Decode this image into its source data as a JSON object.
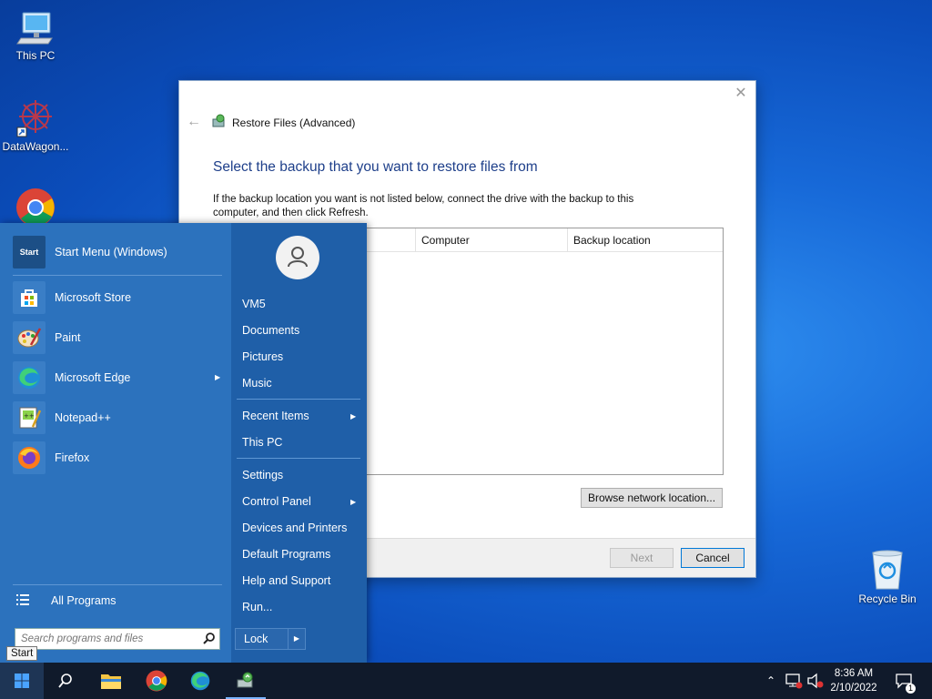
{
  "desktop": {
    "icons": [
      {
        "label": "This PC",
        "icon": "monitor-icon"
      },
      {
        "label": "DataWagon...",
        "icon": "datawagon-icon"
      },
      {
        "label": "",
        "icon": "chrome-icon"
      },
      {
        "label": "Recycle Bin",
        "icon": "recycle-bin-icon"
      }
    ]
  },
  "dialog": {
    "title": "Restore Files (Advanced)",
    "heading": "Select the backup that you want to restore files from",
    "description": "If the backup location you want is not listed below, connect the drive with the backup to this computer, and then click Refresh.",
    "columns": [
      "Computer",
      "Backup location"
    ],
    "browse_button": "Browse network location...",
    "next_button": "Next",
    "cancel_button": "Cancel"
  },
  "start_menu": {
    "pinned": [
      {
        "label": "Start Menu (Windows)",
        "icon": "start-menu-icon"
      },
      {
        "label": "Microsoft Store",
        "icon": "store-icon"
      },
      {
        "label": "Paint",
        "icon": "paint-icon"
      },
      {
        "label": "Microsoft Edge",
        "icon": "edge-icon"
      },
      {
        "label": "Notepad++",
        "icon": "notepad-icon"
      },
      {
        "label": "Firefox",
        "icon": "firefox-icon"
      }
    ],
    "start_icon_text": "Start",
    "all_programs": "All Programs",
    "search_placeholder": "Search programs and files",
    "user_name": "VM5",
    "right_items": {
      "documents": "Documents",
      "pictures": "Pictures",
      "music": "Music",
      "recent_items": "Recent Items",
      "this_pc": "This PC",
      "settings": "Settings",
      "control_panel": "Control Panel",
      "devices_printers": "Devices and Printers",
      "default_programs": "Default Programs",
      "help_support": "Help and Support",
      "run": "Run..."
    },
    "lock_button": "Lock",
    "tooltip": "Start"
  },
  "taskbar": {
    "time": "8:36 AM",
    "date": "2/10/2022",
    "notification_count": "1"
  },
  "colors": {
    "start_left": "#2c72bd",
    "start_right": "#1f5fa8",
    "taskbar": "#101a2b",
    "heading": "#1e3f8a"
  }
}
